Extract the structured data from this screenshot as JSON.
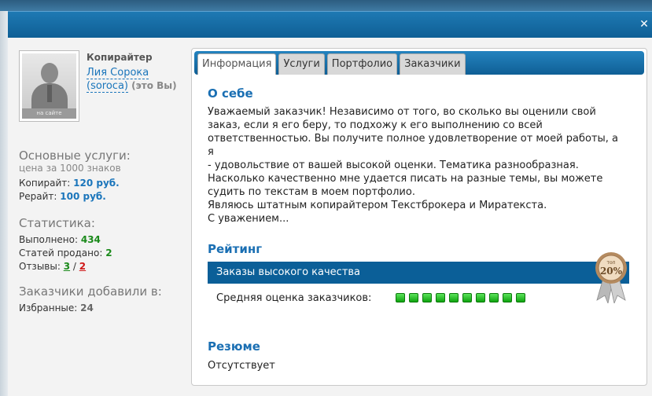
{
  "profile": {
    "role": "Копирайтер",
    "name": "Лия Сорока",
    "login": "(soroca)",
    "you_label": "(это Вы)",
    "avatar_caption": "на сайте"
  },
  "services": {
    "title": "Основные услуги:",
    "subtitle": "цена за 1000 знаков",
    "copywrite_label": "Копирайт:",
    "copywrite_price": "120 руб.",
    "rewrite_label": "Рерайт:",
    "rewrite_price": "100 руб."
  },
  "stats": {
    "title": "Статистика:",
    "done_label": "Выполнено:",
    "done_value": "434",
    "sold_label": "Статей продано:",
    "sold_value": "2",
    "reviews_label": "Отзывы:",
    "reviews_positive": "3",
    "reviews_sep": "/",
    "reviews_negative": "2"
  },
  "added": {
    "title": "Заказчики добавили в:",
    "fav_label": "Избранные:",
    "fav_value": "24"
  },
  "tabs": [
    {
      "label": "Информация",
      "active": true
    },
    {
      "label": "Услуги",
      "active": false
    },
    {
      "label": "Портфолио",
      "active": false
    },
    {
      "label": "Заказчики",
      "active": false
    }
  ],
  "about": {
    "title": "О себе",
    "lines": [
      "Уважаемый заказчик! Независимо от того, во сколько вы оценили свой",
      "заказ, если я его беру, то подхожу к его выполнению со всей",
      "ответственностью. Вы получите полное удовлетворение от моей работы, а я",
      "- удовольствие от вашей высокой оценки. Тематика разнообразная.",
      "Насколько качественно мне удается писать на разные темы, вы можете",
      "судить по текстам в моем портфолио.",
      "Являюсь штатным копирайтером Текстброкера и Миратекста.",
      "С уважением..."
    ]
  },
  "rating": {
    "title": "Рейтинг",
    "bar_label": "Заказы высокого качества",
    "avg_label": "Средняя оценка заказчиков:",
    "avg_score": 10,
    "medal_top": "топ",
    "medal_pct": "20%"
  },
  "resume": {
    "title": "Резюме",
    "text": "Отсутствует"
  },
  "colors": {
    "header": "#0f5f95",
    "link": "#1a75bb",
    "green": "#1b8a1b",
    "red": "#d01818"
  }
}
